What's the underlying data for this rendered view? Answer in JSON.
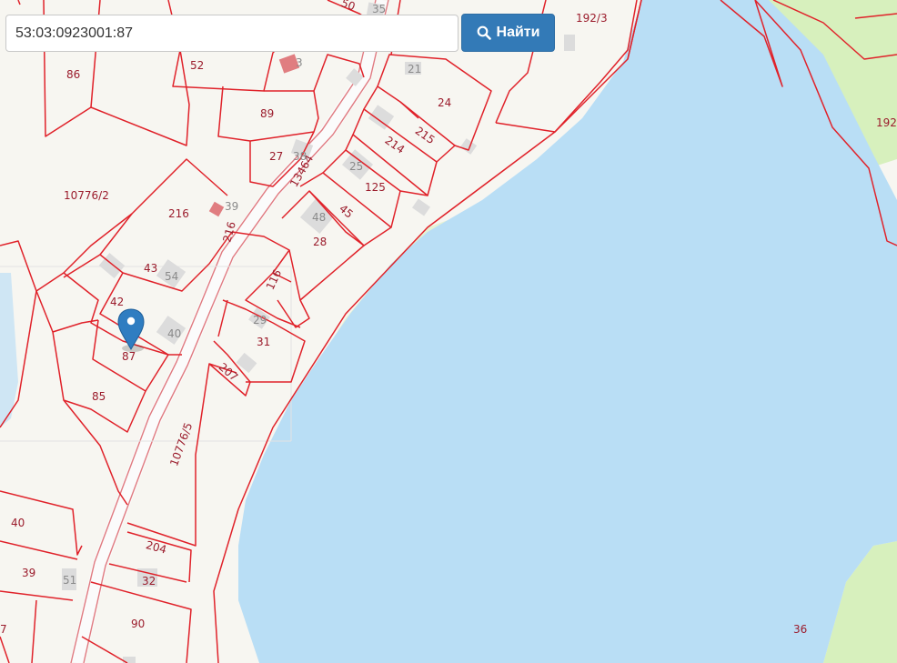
{
  "search": {
    "value": "53:03:0923001:87",
    "button_label": "Найти",
    "button_icon": "search-icon"
  },
  "map": {
    "marker_icon": "map-pin-icon",
    "colors": {
      "water": "#b9def5",
      "meadow": "#d7f0bd",
      "land": "#f7f6f1",
      "parcel_border": "#e0222a",
      "marker": "#2f7dc1"
    },
    "parcel_labels": [
      "50",
      "192/3",
      "86",
      "52",
      "24",
      "89",
      "215",
      "214",
      "27",
      "125",
      "10776/2",
      "216",
      "45",
      "48",
      "28",
      "43",
      "54",
      "116",
      "42",
      "29",
      "31",
      "87",
      "85",
      "207",
      "10776/5",
      "40",
      "204",
      "39",
      "32",
      "90",
      "7",
      "36",
      "192",
      "13464"
    ],
    "building_labels": [
      "35",
      "3",
      "21",
      "38",
      "25",
      "39",
      "40",
      "51"
    ]
  }
}
